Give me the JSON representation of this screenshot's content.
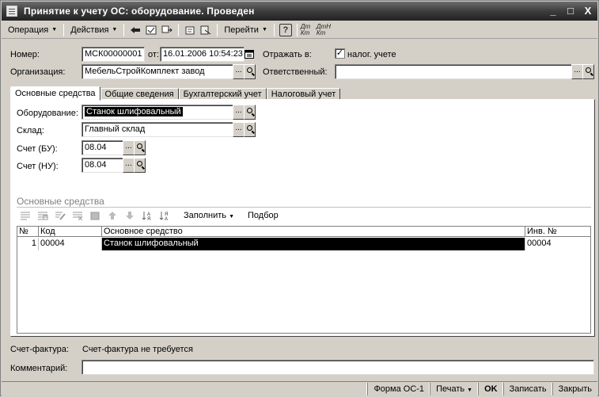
{
  "window": {
    "title": "Принятие к учету ОС: оборудование. Проведен",
    "minimize_label": "_",
    "maximize_label": "□",
    "close_label": "X"
  },
  "toolbar": {
    "operation_label": "Операция",
    "actions_label": "Действия",
    "goto_label": "Перейти",
    "help_label": "?",
    "dt_kt_label": "Дт Кт",
    "dt_n_kt_label": "ДтН Кт"
  },
  "header": {
    "number_label": "Номер:",
    "number_value": "МСК00000001",
    "date_label": "от:",
    "date_value": "16.01.2006 10:54:23",
    "reflect_label": "Отражать в:",
    "tax_accounting_label": "налог. учете",
    "tax_accounting_checked": "✓",
    "organization_label": "Организация:",
    "organization_value": "МебельСтройКомплект завод",
    "responsible_label": "Ответственный:",
    "responsible_value": ""
  },
  "tabs": [
    {
      "label": "Основные средства",
      "active": true
    },
    {
      "label": "Общие сведения"
    },
    {
      "label": "Бухгалтерский учет"
    },
    {
      "label": "Налоговый учет"
    }
  ],
  "main": {
    "equipment_label": "Оборудование:",
    "equipment_value": "Станок шлифовальный",
    "warehouse_label": "Склад:",
    "warehouse_value": "Главный склад",
    "account_bu_label": "Счет (БУ):",
    "account_bu_value": "08.04",
    "account_nu_label": "Счет (НУ):",
    "account_nu_value": "08.04",
    "group_title": "Основные средства",
    "fill_label": "Заполнить",
    "select_label": "Подбор"
  },
  "table": {
    "columns": [
      "№",
      "Код",
      "Основное средство",
      "Инв. №"
    ],
    "rows": [
      {
        "n": "1",
        "code": "00004",
        "asset": "Станок шлифовальный",
        "inv": "00004"
      }
    ]
  },
  "footer": {
    "invoice_label": "Счет-фактура:",
    "invoice_value": "Счет-фактура не требуется",
    "comment_label": "Комментарий:",
    "comment_value": ""
  },
  "statusbar": {
    "form_label": "Форма ОС-1",
    "print_label": "Печать",
    "ok_label": "OK",
    "save_label": "Записать",
    "close_label": "Закрыть"
  }
}
